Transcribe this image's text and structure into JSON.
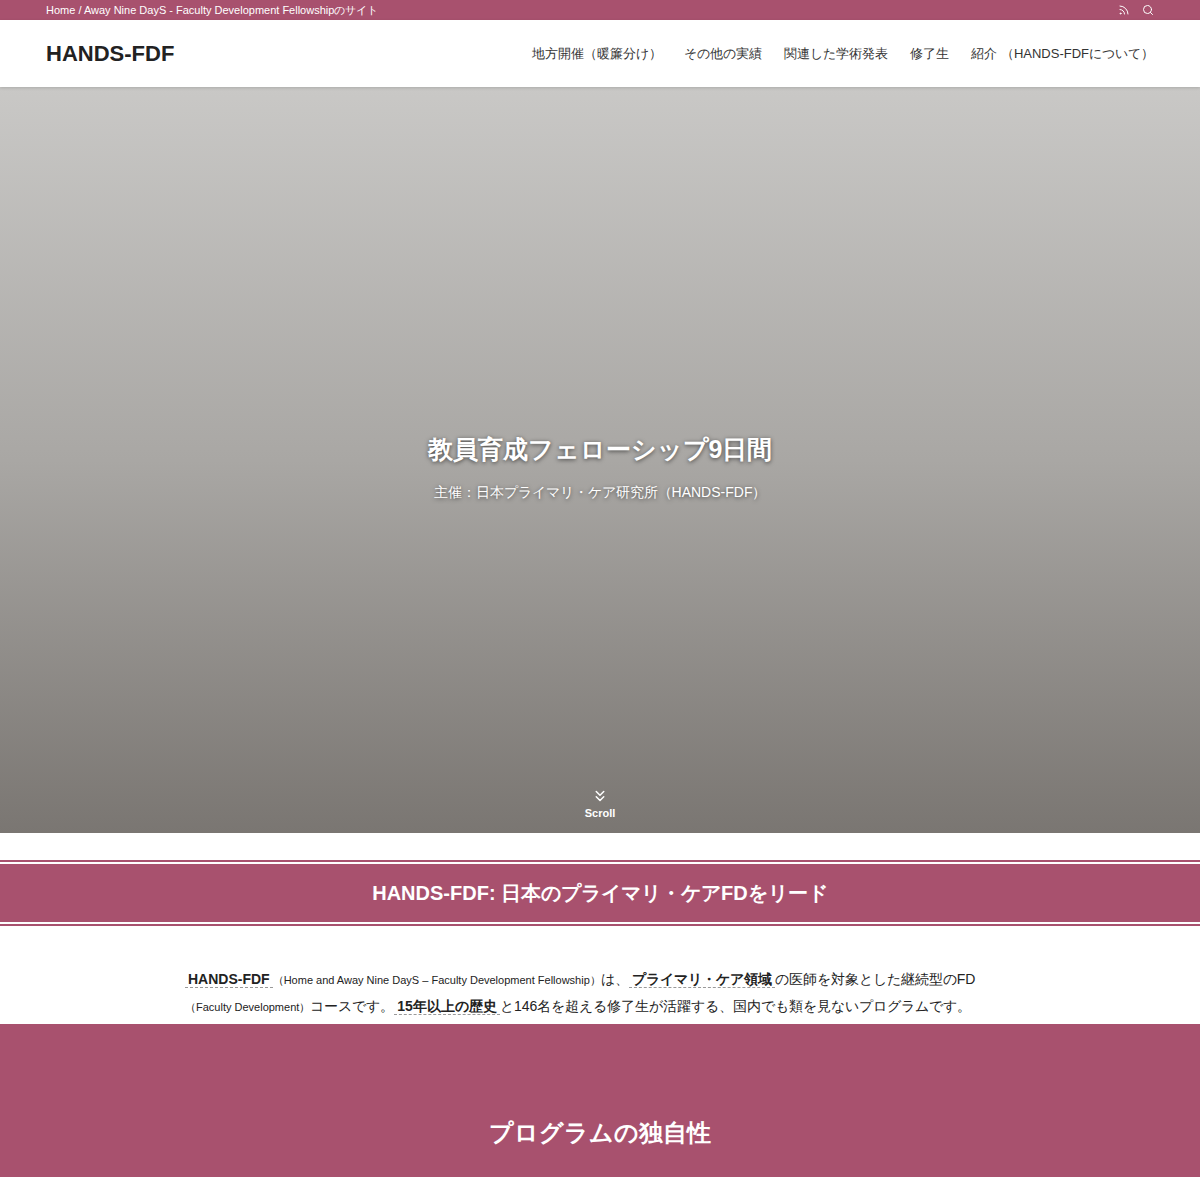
{
  "top_bar": {
    "breadcrumb": "Home / Away Nine DayS - Faculty Development Fellowshipのサイト"
  },
  "header": {
    "logo": "HANDS-FDF",
    "nav": [
      {
        "label": "地方開催（暖簾分け）",
        "selected": false
      },
      {
        "label": "その他の実績",
        "selected": false
      },
      {
        "label": "関連した学術発表",
        "selected": false
      },
      {
        "label": "修了生",
        "selected": false
      },
      {
        "label": "紹介 （HANDS-FDFについて）",
        "selected": false
      }
    ]
  },
  "hero": {
    "title": "教員育成フェローシップ9日間",
    "subtitle": "主催：日本プライマリ・ケア研究所（HANDS-FDF）",
    "scroll": "Scroll"
  },
  "banner": {
    "title": "HANDS-FDF: 日本のプライマリ・ケアFDをリード"
  },
  "intro": [
    {
      "kind": "term",
      "text": "HANDS-FDF"
    },
    {
      "kind": "small",
      "text": "（Home and Away Nine DayS – Faculty Development Fellowship）"
    },
    {
      "kind": "plain",
      "text": "は、"
    },
    {
      "kind": "term",
      "text": "プライマリ・ケア領域"
    },
    {
      "kind": "plain",
      "text": "の医師を対象とした継続型のFD"
    },
    {
      "kind": "small",
      "text": "（Faculty Development）"
    },
    {
      "kind": "plain",
      "text": "コースです。"
    },
    {
      "kind": "term",
      "text": "15年以上の歴史"
    },
    {
      "kind": "plain",
      "text": "と146名を超える修了生が活躍する、国内でも類を見ないプログラムです。"
    }
  ],
  "section": {
    "title": "プログラムの独自性"
  }
}
